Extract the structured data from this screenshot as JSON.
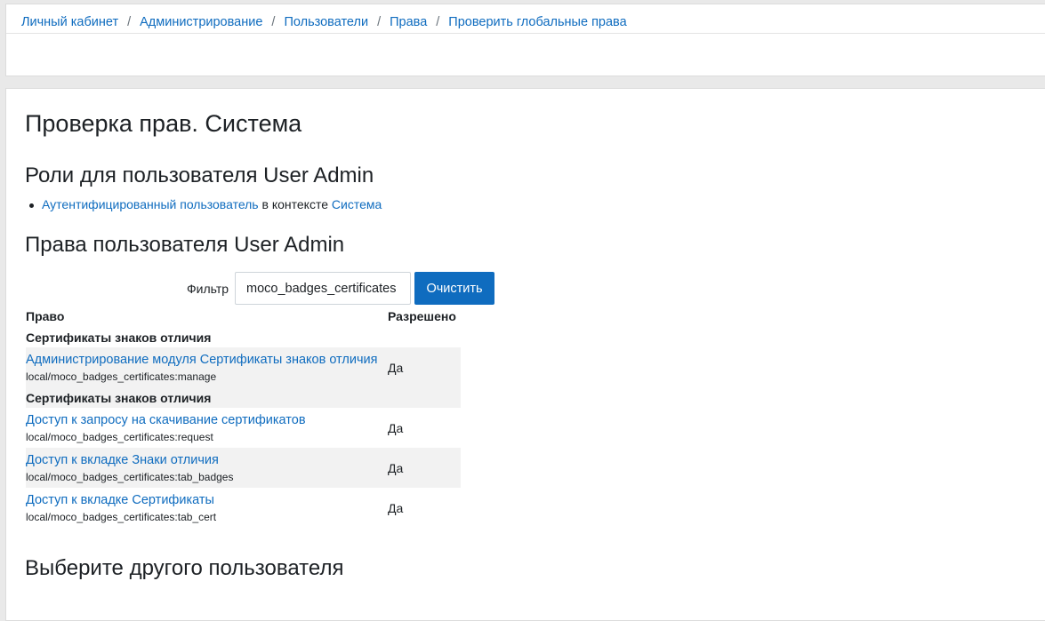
{
  "breadcrumb": [
    "Личный кабинет",
    "Администрирование",
    "Пользователи",
    "Права",
    "Проверить глобальные права"
  ],
  "page_title": "Проверка прав. Система",
  "roles_heading": "Роли для пользователя User Admin",
  "roles": [
    {
      "role": "Аутентифицированный пользователь",
      "in_context": "в контексте",
      "context": "Система"
    }
  ],
  "permissions_heading": "Права пользователя User Admin",
  "filter": {
    "label": "Фильтр",
    "value": "moco_badges_certificates",
    "clear_label": "Очистить"
  },
  "table": {
    "headers": [
      "Право",
      "Разрешено"
    ],
    "groups": [
      {
        "name": "Сертификаты знаков отличия",
        "rows": [
          {
            "label": "Администрирование модуля Сертификаты знаков отличия",
            "code": "local/moco_badges_certificates:manage",
            "allowed": "Да"
          }
        ]
      },
      {
        "name": "Сертификаты знаков отличия",
        "rows": [
          {
            "label": "Доступ к запросу на скачивание сертификатов",
            "code": "local/moco_badges_certificates:request",
            "allowed": "Да"
          },
          {
            "label": "Доступ к вкладке Знаки отличия",
            "code": "local/moco_badges_certificates:tab_badges",
            "allowed": "Да"
          },
          {
            "label": "Доступ к вкладке Сертификаты",
            "code": "local/moco_badges_certificates:tab_cert",
            "allowed": "Да"
          }
        ]
      }
    ]
  },
  "select_user_heading": "Выберите другого пользователя"
}
